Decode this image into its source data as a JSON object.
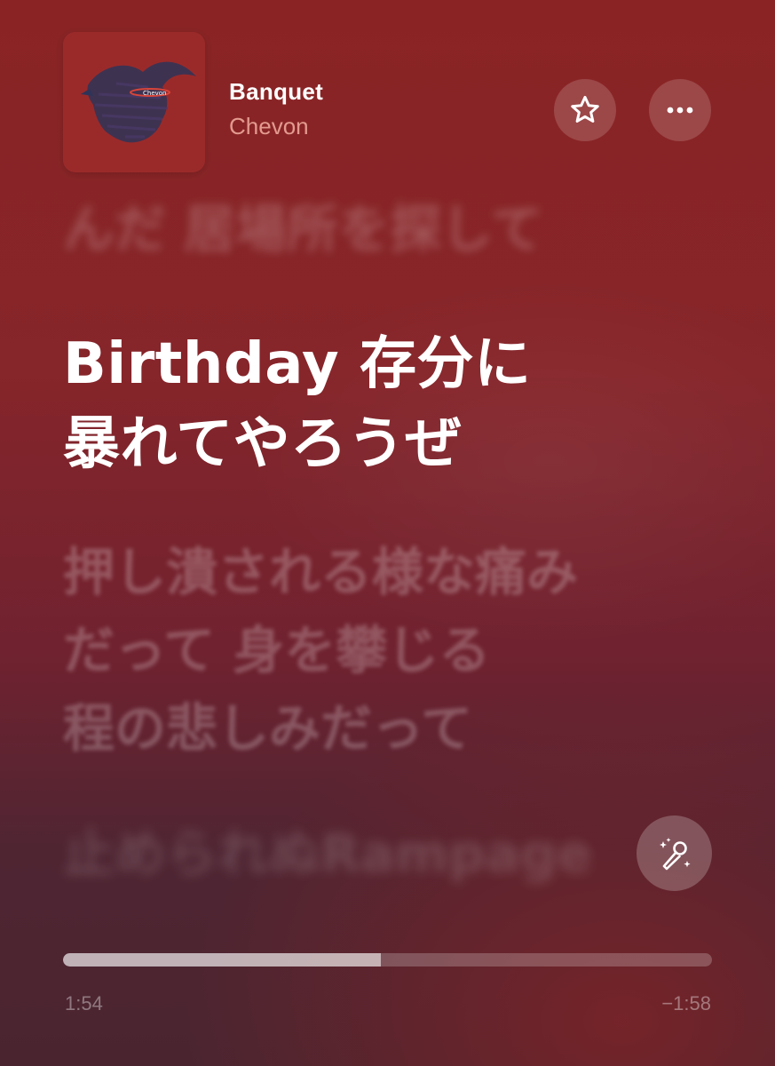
{
  "track": {
    "title": "Banquet",
    "artist": "Chevon"
  },
  "artwork": {
    "background": "#9a2a2a",
    "figure_color": "#2e3458",
    "accent_color": "#d8453a",
    "label": "Chevon"
  },
  "actions": {
    "favorite_icon": "star-icon",
    "more_icon": "ellipsis-icon",
    "sing_icon": "microphone-sparkle-icon"
  },
  "lyrics": {
    "previous": "んだ 居場所を探して",
    "current_lines": [
      "Birthday 存分に",
      "暴れてやろうぜ"
    ],
    "next_lines": [
      "押し潰される様な痛み",
      "だって 身を攀じる",
      "程の悲しみだって"
    ],
    "following": "止められぬRampage"
  },
  "playback": {
    "elapsed": "1:54",
    "remaining": "−1:58",
    "progress": 0.49
  },
  "colors": {
    "accent_artist": "#e39a8f",
    "background_top": "#8a2424",
    "background_bottom": "#4a2530"
  }
}
